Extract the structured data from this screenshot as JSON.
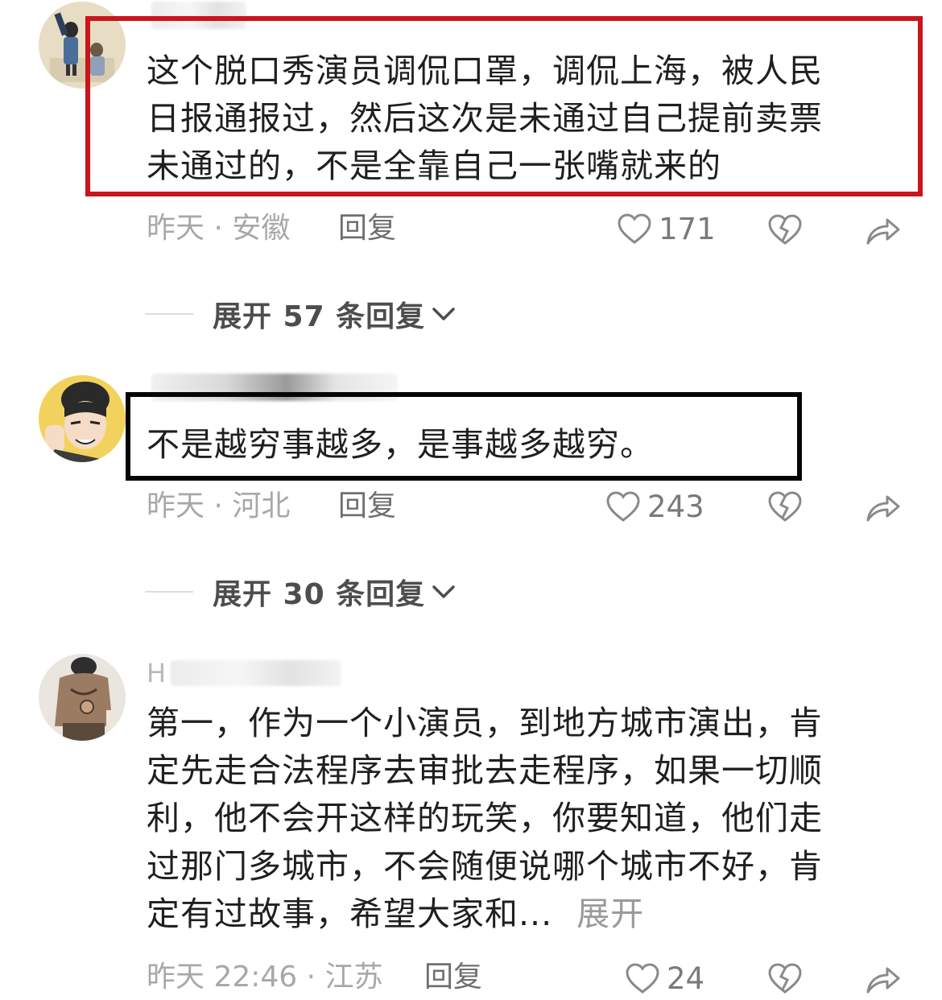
{
  "comments": [
    {
      "lines": [
        "这个脱口秀演员调侃口罩，调侃上海，被人民",
        "日报通报过，然后这次是未通过自己提前卖票",
        "未通过的，不是全靠自己一张嘴就来的"
      ],
      "time": "昨天",
      "location": "安徽",
      "reply_label": "回复",
      "likes": "171",
      "expand_replies": "展开 57 条回复"
    },
    {
      "lines": [
        "不是越穷事越多，是事越多越穷。"
      ],
      "time": "昨天",
      "location": "河北",
      "reply_label": "回复",
      "likes": "243",
      "expand_replies": "展开 30 条回复"
    },
    {
      "username_visible": "H",
      "lines": [
        "第一，作为一个小演员，到地方城市演出，肯",
        "定先走合法程序去审批去走程序，如果一切顺",
        "利，他不会开这样的玩笑，你要知道，他们走",
        "过那门多城市，不会随便说哪个城市不好，肯",
        "定有过故事，希望大家和..."
      ],
      "inline_expand": "展开",
      "time": "昨天 22:46",
      "location": "江苏",
      "reply_label": "回复",
      "likes": "24"
    }
  ],
  "separator": "·",
  "icons": {
    "like": "heart-outline-icon",
    "dislike": "broken-heart-icon",
    "share": "share-arrow-icon",
    "chevron": "chevron-down-icon"
  },
  "colors": {
    "highlight_red": "#c8161d",
    "highlight_black": "#050505",
    "meta_gray": "#a8a8a8"
  }
}
